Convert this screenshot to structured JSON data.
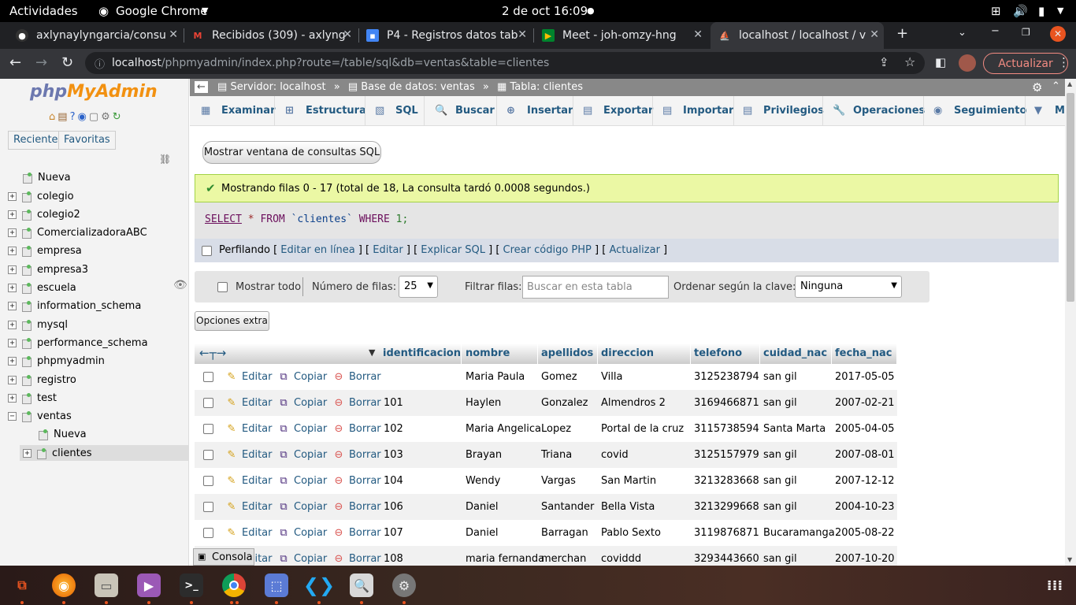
{
  "system": {
    "activities": "Actividades",
    "app_name": "Google Chrome",
    "datetime": "2 de oct  16:09"
  },
  "tabs": [
    {
      "title": "axlynaylyngarcia/consu",
      "icon": "github-icon"
    },
    {
      "title": "Recibidos (309) - axlyng",
      "icon": "gmail-icon"
    },
    {
      "title": "P4 - Registros datos tab",
      "icon": "docs-icon"
    },
    {
      "title": "Meet - joh-omzy-hng",
      "icon": "meet-icon"
    },
    {
      "title": "localhost / localhost / v",
      "icon": "pma-icon",
      "active": true
    }
  ],
  "address": {
    "host": "localhost",
    "path": "/phpmyadmin/index.php?route=/table/sql&db=ventas&table=clientes"
  },
  "update_label": "Actualizar",
  "sidebar": {
    "logo_php": "php",
    "logo_my": "MyAdmin",
    "recent": "Reciente",
    "favorites": "Favoritas",
    "new_label": "Nueva",
    "databases": [
      "colegio",
      "colegio2",
      "ComercializadoraABC",
      "empresa",
      "empresa3",
      "escuela",
      "information_schema",
      "mysql",
      "performance_schema",
      "phpmyadmin",
      "registro",
      "test",
      "ventas"
    ],
    "ventas_new": "Nueva",
    "ventas_table": "clientes"
  },
  "breadcrumb": {
    "server": "Servidor: localhost",
    "database": "Base de datos: ventas",
    "table": "Tabla: clientes",
    "sep": "»"
  },
  "menu": [
    "Examinar",
    "Estructura",
    "SQL",
    "Buscar",
    "Insertar",
    "Exportar",
    "Importar",
    "Privilegios",
    "Operaciones",
    "Seguimiento",
    "Más"
  ],
  "show_sql_window": "Mostrar ventana de consultas SQL",
  "success_message": "Mostrando filas 0 - 17 (total de 18, La consulta tardó 0.0008 segundos.)",
  "sql": {
    "select": "SELECT",
    "star": "*",
    "from": "FROM",
    "table": "`clientes`",
    "where": "WHERE",
    "cond": "1;"
  },
  "profiling": {
    "label": "Perfilando",
    "links": [
      "Editar en línea",
      "Editar",
      "Explicar SQL",
      "Crear código PHP",
      "Actualizar"
    ]
  },
  "nav": {
    "show_all": "Mostrar todo",
    "rows_label": "Número de filas:",
    "rows_value": "25",
    "filter_label": "Filtrar filas:",
    "search_placeholder": "Buscar en esta tabla",
    "sort_label": "Ordenar según la clave:",
    "sort_value": "Ninguna"
  },
  "extra_options": "Opciones extra",
  "columns": [
    "identificacion",
    "nombre",
    "apellidos",
    "direccion",
    "telefono",
    "cuidad_nac",
    "fecha_nac"
  ],
  "actions": {
    "edit": "Editar",
    "copy": "Copiar",
    "delete": "Borrar"
  },
  "rows": [
    [
      "",
      "Maria Paula",
      "Gomez",
      "Villa",
      "3125238794",
      "san gil",
      "2017-05-05"
    ],
    [
      "101",
      "Haylen",
      "Gonzalez",
      "Almendros 2",
      "3169466871",
      "san gil",
      "2007-02-21"
    ],
    [
      "102",
      "Maria Angelica",
      "Lopez",
      "Portal de la cruz",
      "3115738594",
      "Santa Marta",
      "2005-04-05"
    ],
    [
      "103",
      "Brayan",
      "Triana",
      "covid",
      "3125157979",
      "san gil",
      "2007-08-01"
    ],
    [
      "104",
      "Wendy",
      "Vargas",
      "San Martin",
      "3213283668",
      "san gil",
      "2007-12-12"
    ],
    [
      "106",
      "Daniel",
      "Santander",
      "Bella Vista",
      "3213299668",
      "san gil",
      "2004-10-23"
    ],
    [
      "107",
      "Daniel",
      "Barragan",
      "Pablo Sexto",
      "3119876871",
      "Bucaramanga",
      "2005-08-22"
    ],
    [
      "108",
      "maria fernanda",
      "merchan",
      "coviddd",
      "3293443660",
      "san gil",
      "2007-10-20"
    ]
  ],
  "console_label": "Consola",
  "dock": [
    "screenshot-icon",
    "firefox-icon",
    "files-icon",
    "videos-icon",
    "terminal-icon",
    "chrome-icon",
    "screenshot-tool-icon",
    "vscode-icon",
    "image-viewer-icon",
    "settings-icon",
    "app-grid-icon"
  ]
}
